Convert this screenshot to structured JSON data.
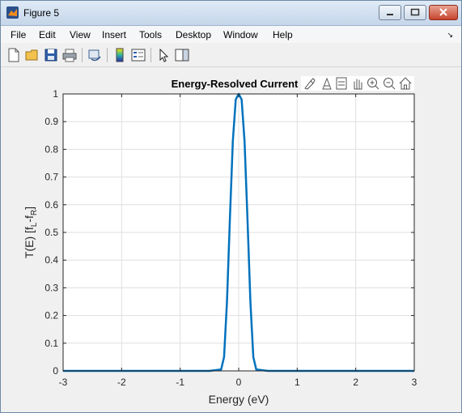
{
  "window": {
    "title": "Figure 5"
  },
  "menu": [
    "File",
    "Edit",
    "View",
    "Insert",
    "Tools",
    "Desktop",
    "Window",
    "Help"
  ],
  "menu_overflow": "↘",
  "toolbar_icons": [
    "new-figure-icon",
    "open-file-icon",
    "save-icon",
    "print-icon",
    "link-plot-icon",
    "colorbar-icon",
    "legend-icon",
    "pointer-icon",
    "property-inspector-icon"
  ],
  "axes_toolbar_icons": [
    "brush-icon",
    "data-tips-icon",
    "pan-icon",
    "zoom-in-icon",
    "zoom-out-icon",
    "home-icon"
  ],
  "chart_data": {
    "type": "line",
    "title": "Energy-Resolved Current",
    "xlabel": "Energy (eV)",
    "ylabel_main": "T(E) [f",
    "ylabel_sub1": "L",
    "ylabel_mid": "-f",
    "ylabel_sub2": "R",
    "ylabel_end": "]",
    "xlim": [
      -3,
      3
    ],
    "ylim": [
      0,
      1
    ],
    "xticks": [
      "-3",
      "-2",
      "-1",
      "0",
      "1",
      "2",
      "3"
    ],
    "yticks": [
      "0",
      "0.1",
      "0.2",
      "0.3",
      "0.4",
      "0.5",
      "0.6",
      "0.7",
      "0.8",
      "0.9",
      "1"
    ],
    "grid": true,
    "series": [
      {
        "color": "#0072bd",
        "x": [
          -3,
          -0.5,
          -0.3,
          -0.25,
          -0.2,
          -0.15,
          -0.1,
          -0.05,
          0,
          0.05,
          0.1,
          0.15,
          0.2,
          0.25,
          0.3,
          0.5,
          3
        ],
        "y": [
          0,
          0,
          0.005,
          0.05,
          0.25,
          0.55,
          0.83,
          0.98,
          1,
          0.98,
          0.83,
          0.55,
          0.25,
          0.05,
          0.005,
          0,
          0
        ]
      }
    ]
  }
}
